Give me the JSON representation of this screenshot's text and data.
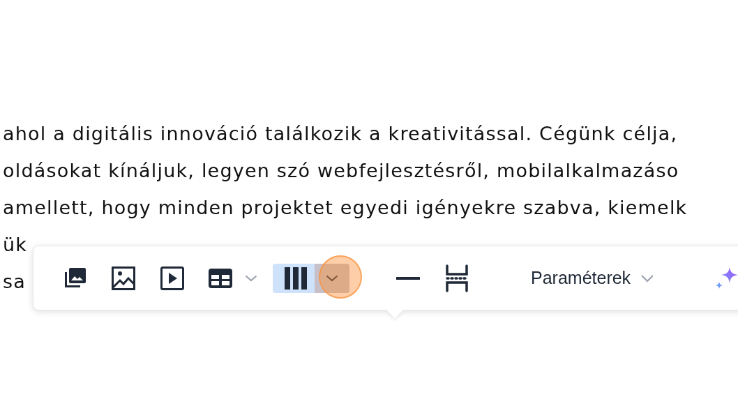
{
  "paragraph": {
    "lines": [
      "ahol a digitális innováció találkozik a kreativitással. Cégünk célja,",
      "oldásokat kínáljuk, legyen szó webfejlesztésről, mobilalkalmazáso",
      "amellett, hogy minden projektet egyedi igényekre szabva, kiemelk",
      "ük",
      "sa"
    ]
  },
  "toolbar": {
    "items": [
      {
        "kind": "button",
        "selected": false,
        "clicked": false
      },
      {
        "kind": "button",
        "selected": false,
        "clicked": false
      },
      {
        "kind": "button",
        "selected": false,
        "clicked": false
      },
      {
        "kind": "split",
        "selected": false,
        "clicked": false
      },
      {
        "kind": "split",
        "selected": true,
        "clicked": true
      },
      {
        "kind": "button",
        "selected": false,
        "clicked": false
      },
      {
        "kind": "button",
        "selected": false,
        "clicked": false
      },
      {
        "kind": "menu",
        "label": "Paraméterek",
        "clicked": false
      },
      {
        "kind": "button",
        "selected": false,
        "clicked": false
      }
    ]
  }
}
